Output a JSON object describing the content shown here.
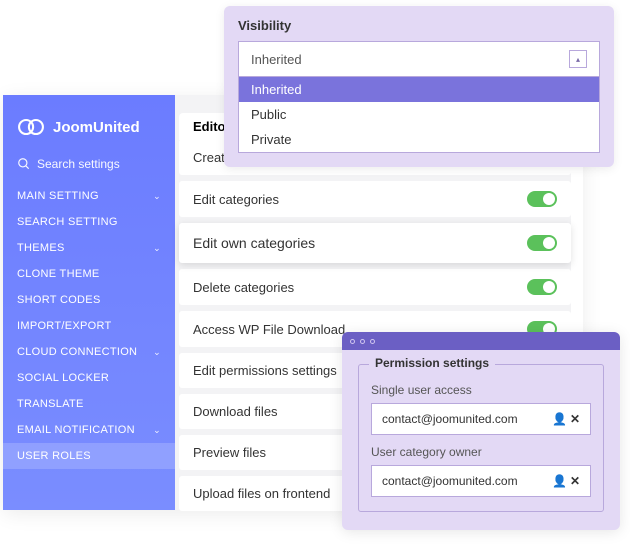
{
  "brand": "JoomUnited",
  "search": {
    "placeholder": "Search settings"
  },
  "sidebar": {
    "items": [
      {
        "label": "MAIN SETTING",
        "chevron": true
      },
      {
        "label": "SEARCH SETTING"
      },
      {
        "label": "THEMES",
        "chevron": true
      },
      {
        "label": "CLONE THEME"
      },
      {
        "label": "SHORT CODES"
      },
      {
        "label": "IMPORT/EXPORT"
      },
      {
        "label": "CLOUD CONNECTION",
        "chevron": true
      },
      {
        "label": "SOCIAL LOCKER"
      },
      {
        "label": "TRANSLATE"
      },
      {
        "label": "EMAIL NOTIFICATION",
        "chevron": true
      },
      {
        "label": "USER ROLES",
        "active": true
      }
    ]
  },
  "editor": {
    "tab_label": "Editor",
    "permissions": [
      {
        "label": "Create categories",
        "on": true
      },
      {
        "label": "Edit categories",
        "on": true
      },
      {
        "label": "Edit own categories",
        "on": true,
        "highlighted": true
      },
      {
        "label": "Delete categories",
        "on": true
      },
      {
        "label": "Access WP File Download",
        "on": true
      },
      {
        "label": "Edit permissions settings"
      },
      {
        "label": "Download files"
      },
      {
        "label": "Preview files"
      },
      {
        "label": "Upload files on frontend"
      }
    ]
  },
  "visibility": {
    "title": "Visibility",
    "selected": "Inherited",
    "options": [
      "Inherited",
      "Public",
      "Private"
    ]
  },
  "permission_settings": {
    "legend": "Permission settings",
    "single_label": "Single user access",
    "single_value": "contact@joomunited.com",
    "owner_label": "User category owner",
    "owner_value": "contact@joomunited.com"
  }
}
